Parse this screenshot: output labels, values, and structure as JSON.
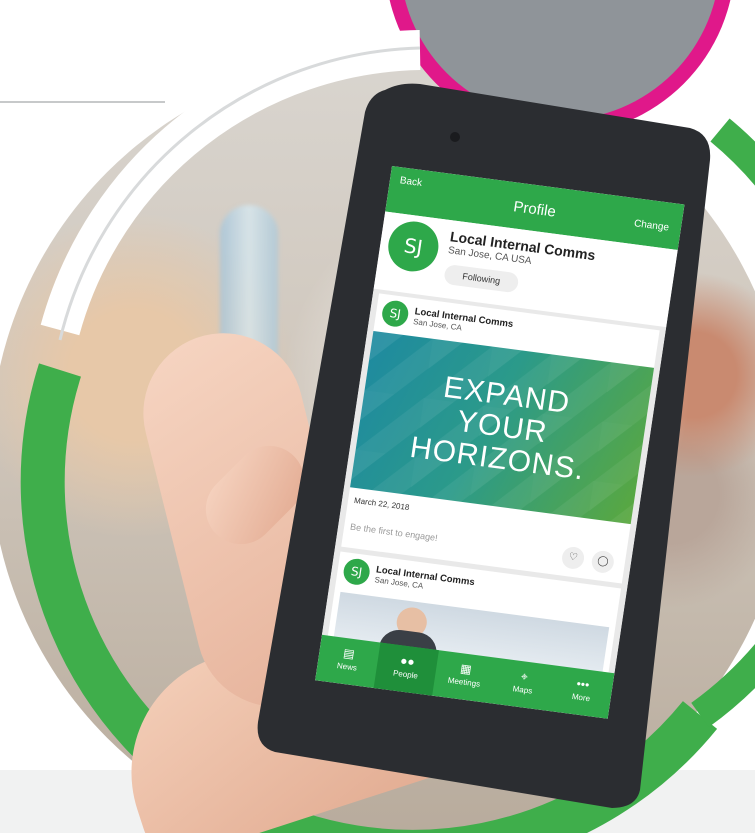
{
  "screen": {
    "back_label": "Back",
    "title": "Profile",
    "change_label": "Change"
  },
  "profile": {
    "initials": "SJ",
    "name": "Local Internal Comms",
    "location": "San Jose, CA USA",
    "follow_label": "Following"
  },
  "feed": {
    "posts": [
      {
        "initials": "SJ",
        "author": "Local Internal Comms",
        "location": "San Jose, CA",
        "banner_lines": [
          "EXPAND",
          "YOUR",
          "HORIZONS."
        ],
        "date": "March 22, 2018",
        "engage_prompt": "Be the first to engage!",
        "like_icon": "heart-icon",
        "comment_icon": "speech-bubble-icon"
      },
      {
        "initials": "SJ",
        "author": "Local Internal Comms",
        "location": "San Jose, CA"
      }
    ]
  },
  "tabbar": {
    "active": "People",
    "items": [
      {
        "label": "News",
        "icon": "newspaper-icon"
      },
      {
        "label": "People",
        "icon": "people-icon"
      },
      {
        "label": "Meetings",
        "icon": "calendar-icon"
      },
      {
        "label": "Maps",
        "icon": "map-pin-icon"
      },
      {
        "label": "More",
        "icon": "more-dots-icon"
      }
    ]
  },
  "colors": {
    "brand_green": "#2ea84a",
    "ring_green": "#3fae4b",
    "accent_magenta": "#e0188a",
    "phone_body": "#2b2d31"
  }
}
